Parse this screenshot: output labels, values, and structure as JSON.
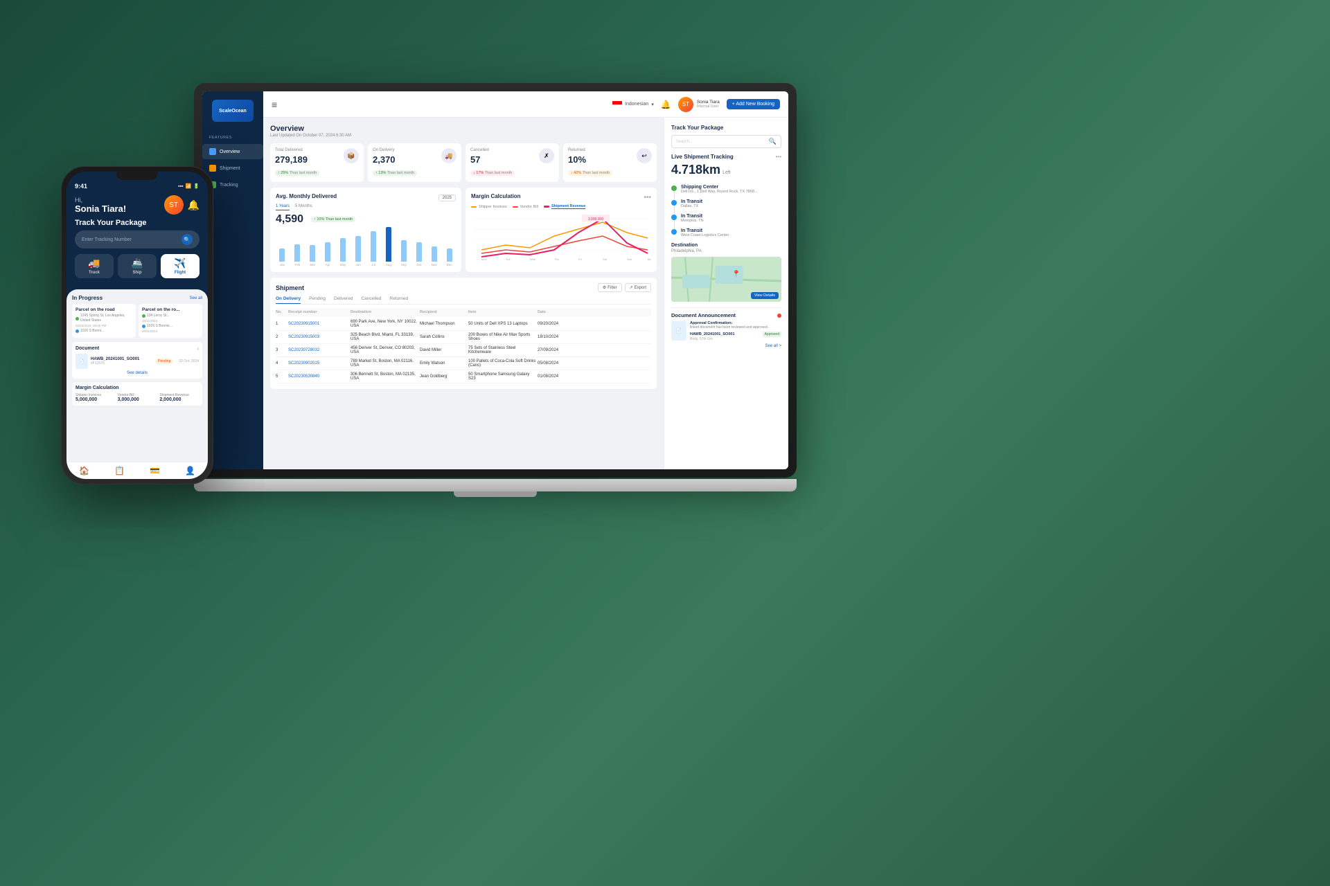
{
  "page": {
    "background": "#2d6b52"
  },
  "laptop": {
    "sidebar": {
      "logo": "ScaleOcean",
      "features_label": "FEATURES",
      "items": [
        {
          "id": "overview",
          "label": "Overview",
          "active": true
        },
        {
          "id": "shipment",
          "label": "Shipment",
          "active": false
        },
        {
          "id": "tracking",
          "label": "Tracking",
          "active": false
        }
      ]
    },
    "topbar": {
      "lang": "Indonesian",
      "user_name": "Sonia Tiara",
      "user_role": "Internal User",
      "add_booking_label": "+ Add New Booking",
      "hamburger": "≡"
    },
    "overview": {
      "title": "Overview",
      "subtitle": "Last Updated On October 07, 2024 6:30 AM"
    },
    "stats": [
      {
        "label": "Total Delivered",
        "value": "279,189",
        "badge": "↑ 25%",
        "badge_type": "green",
        "badge_sub": "Than last month",
        "icon": "📦"
      },
      {
        "label": "On Delivery",
        "value": "2,370",
        "badge": "↑ 13%",
        "badge_type": "green",
        "badge_sub": "Than last month",
        "icon": "🚚"
      },
      {
        "label": "Cancelled",
        "value": "57",
        "badge": "↓ 17%",
        "badge_type": "red",
        "badge_sub": "Than last month",
        "icon": "✗"
      },
      {
        "label": "Returned",
        "value": "10%",
        "badge": "↓ 42%",
        "badge_type": "orange",
        "badge_sub": "Than last month",
        "icon": "↩"
      }
    ],
    "avg_monthly": {
      "title": "Avg. Monthly Delivered",
      "tabs": [
        "1 Years",
        "5 Months"
      ],
      "year_btn": "2025",
      "value": "4,590",
      "trend": "↑ 10% Than last month",
      "months": [
        "Jan",
        "Feb",
        "Mar",
        "Apr",
        "May",
        "Jun",
        "Jul",
        "Aug",
        "Sep",
        "Oct",
        "Nov",
        "Dec"
      ],
      "bars": [
        30,
        40,
        38,
        45,
        55,
        60,
        70,
        80,
        50,
        45,
        35,
        30
      ]
    },
    "margin": {
      "title": "Margin Calculation",
      "legend": [
        "Shipper Invoices",
        "Vendor Bill",
        "Shipment Revenue"
      ],
      "legend_colors": [
        "#ff9800",
        "#f44336",
        "#e91e63"
      ],
      "peak_label": "3,000,000",
      "x_labels": [
        "Mon",
        "Tue",
        "Wed",
        "Thu",
        "Fri",
        "Sat",
        "Sun",
        "Mon"
      ]
    },
    "shipment": {
      "title": "Shipment",
      "filter_label": "Filter",
      "export_label": "Export",
      "tabs": [
        "On Delivery",
        "Pending",
        "Delivered",
        "Cancelled",
        "Returned"
      ],
      "active_tab": "On Delivery",
      "columns": [
        "No.",
        "Receipt number",
        "Destination",
        "Recipient",
        "Item",
        "Date"
      ],
      "rows": [
        {
          "no": 1,
          "receipt": "SC20230915001",
          "dest": "690 Park Ave, New York, NY 10022, USA",
          "recipient": "Michael Thompson",
          "item": "50 Units of Dell XPS 13 Laptops",
          "date": "09/20/2024"
        },
        {
          "no": 2,
          "receipt": "SC20230915003",
          "dest": "325 Beach Blvd, Miami, FL 33139, USA",
          "recipient": "Sarah Collins",
          "item": "200 Boxes of Nike Air Max Sports Shoes",
          "date": "18/10/2024"
        },
        {
          "no": 3,
          "receipt": "SC20230728032",
          "dest": "456 Denver St, Denver, CO 80203, USA",
          "recipient": "David Miller",
          "item": "75 Sets of Stainless Steel Kitchenware",
          "date": "27/09/2024"
        },
        {
          "no": 4,
          "receipt": "SC20230902015",
          "dest": "789 Market St, Boston, MA 02116, USA",
          "recipient": "Emily Watson",
          "item": "100 Pallets of Coca-Cola Soft Drinks (Cans)",
          "date": "05/08/2024"
        },
        {
          "no": 5,
          "receipt": "SC20230530840",
          "dest": "306 Bennett St, Boston, MA 02135, USA",
          "recipient": "Jean Goldberg",
          "item": "50 Smartphone Samsung Galaxy S23",
          "date": "01/08/2024"
        }
      ]
    },
    "tracking_panel": {
      "title": "Track Your Package",
      "search_placeholder": "Search...",
      "live_title": "Live Shipment Tracking",
      "distance": "4.718km",
      "distance_label": "Left",
      "steps": [
        {
          "type": "green",
          "label": "Shipping Center",
          "sub": "Dell Inc., 1 Dell Way, Round Rock, TX 7868..."
        },
        {
          "type": "blue",
          "label": "In Transit",
          "sub": "Dallas, TX"
        },
        {
          "type": "blue",
          "label": "In Transit",
          "sub": "Memphis, TN"
        },
        {
          "type": "blue",
          "label": "In Transit",
          "sub": "West Coast Logistics Center"
        }
      ],
      "destination_label": "Destination",
      "destination_city": "Philadelphia, PA",
      "view_details": "View Details",
      "doc_title": "Document Announcement",
      "doc_approval": "Approval Confirmation:",
      "doc_desc": "linked document has been reviewed and approved.",
      "doc_filename": "HAWB_20241001_SO001",
      "doc_date": "Body, 07th Oct",
      "approval_badge": "Approved",
      "see_all": "See all >"
    }
  },
  "phone": {
    "time": "9:41",
    "greeting": "Hi,",
    "name": "Sonia Tiara!",
    "track_title": "Track Your Package",
    "search_placeholder": "Enter Tracking Number",
    "transport_tabs": [
      {
        "label": "Truck",
        "icon": "🚚",
        "active": false
      },
      {
        "label": "Ship",
        "icon": "🚢",
        "active": false
      },
      {
        "label": "Flight",
        "icon": "✈️",
        "active": true
      }
    ],
    "in_progress_title": "In Progress",
    "see_all": "See all",
    "parcels": [
      {
        "title": "Parcel on the road",
        "addresses": [
          {
            "dot": "green",
            "text": "1245 Spring St, Los Angeles, United States",
            "date": "02/10/2024, 09:00 PM"
          },
          {
            "dot": "blue",
            "text": "1026 S Bonni...",
            "date": ""
          }
        ]
      },
      {
        "title": "Parcel on the ro...",
        "addresses": [
          {
            "dot": "green",
            "text": "134 Leroy St...",
            "date": "15/11/2024"
          },
          {
            "dot": "blue",
            "text": "1026 S Bonnie...",
            "date": "20/11/2024"
          }
        ]
      }
    ],
    "document_title": "Document",
    "document": {
      "name": "HAWB_20241001_SO001",
      "id": "#F12675",
      "status": "Pending",
      "date": "02 Oct, 2024"
    },
    "see_details": "See details",
    "margin_title": "Margin Calculation",
    "margin_items": [
      {
        "label": "Shipper Invoices",
        "value": "5,000,000"
      },
      {
        "label": "Vendor Bill",
        "value": "3,000,000"
      },
      {
        "label": "Shipment Revenue",
        "value": "2,000,000"
      }
    ],
    "nav_items": [
      "🏠",
      "📋",
      "💳",
      "👤"
    ]
  }
}
